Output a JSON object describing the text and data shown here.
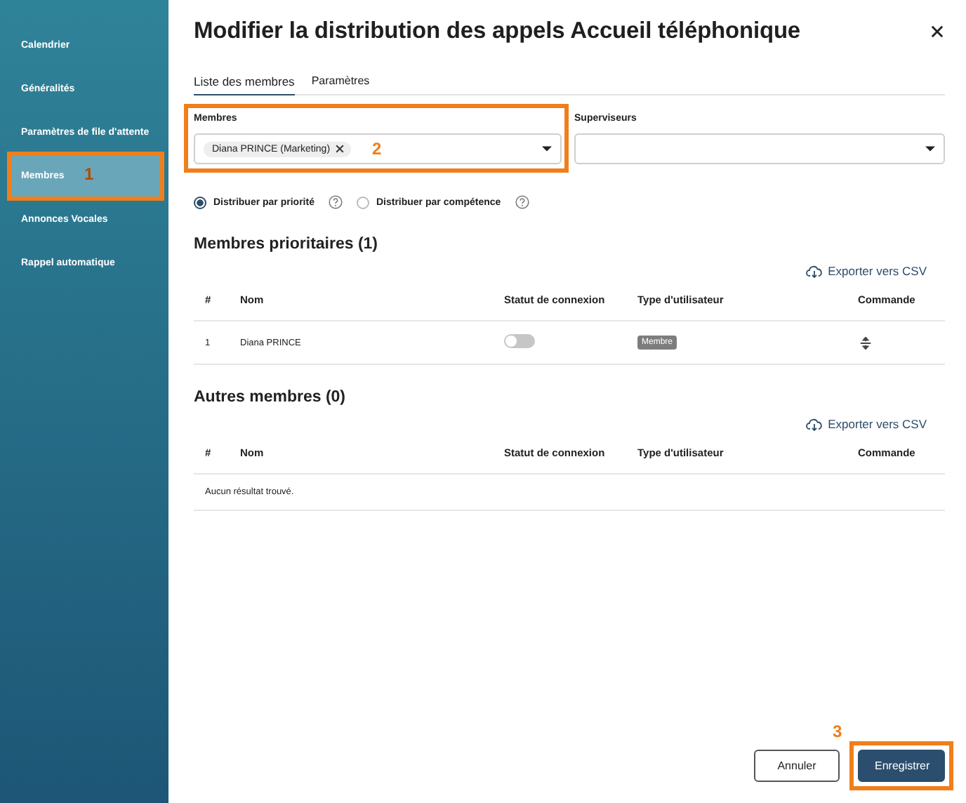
{
  "sidebar": {
    "items": [
      {
        "label": "Calendrier",
        "selected": false
      },
      {
        "label": "Généralités",
        "selected": false
      },
      {
        "label": "Paramètres de file d'attente",
        "selected": false
      },
      {
        "label": "Membres",
        "selected": true,
        "callout": "1"
      },
      {
        "label": "Annonces Vocales",
        "selected": false
      },
      {
        "label": "Rappel automatique",
        "selected": false
      }
    ]
  },
  "dialog": {
    "title": "Modifier la distribution des appels Accueil téléphonique"
  },
  "tabs": [
    {
      "label": "Liste des membres",
      "selected": true
    },
    {
      "label": "Paramètres",
      "selected": false
    }
  ],
  "fields": [
    {
      "label": "Membres",
      "tags": [
        "Diana PRINCE (Marketing)"
      ],
      "callout": "2"
    },
    {
      "label": "Superviseurs"
    }
  ],
  "distribution": [
    {
      "label": "Distribuer par priorité",
      "selected": true
    },
    {
      "label": "Distribuer par compétence",
      "selected": false
    }
  ],
  "sections": [
    {
      "title": "Membres prioritaires (1)",
      "export": "Exporter vers CSV",
      "columns": [
        "#",
        "Nom",
        "Statut de connexion",
        "Type d'utilisateur",
        "Commande"
      ],
      "rows": [
        {
          "number": "1",
          "name": "Diana PRINCE",
          "online": false,
          "type": "Membre"
        }
      ]
    },
    {
      "title": "Autres membres (0)",
      "export": "Exporter vers CSV",
      "columns": [
        "#",
        "Nom",
        "Statut de connexion",
        "Type d'utilisateur",
        "Commande"
      ],
      "empty": "Aucun résultat trouvé."
    }
  ],
  "buttons": [
    {
      "label": "Annuler",
      "kind": "secondary"
    },
    {
      "label": "Enregistrer",
      "kind": "primary",
      "callout": "3"
    }
  ]
}
